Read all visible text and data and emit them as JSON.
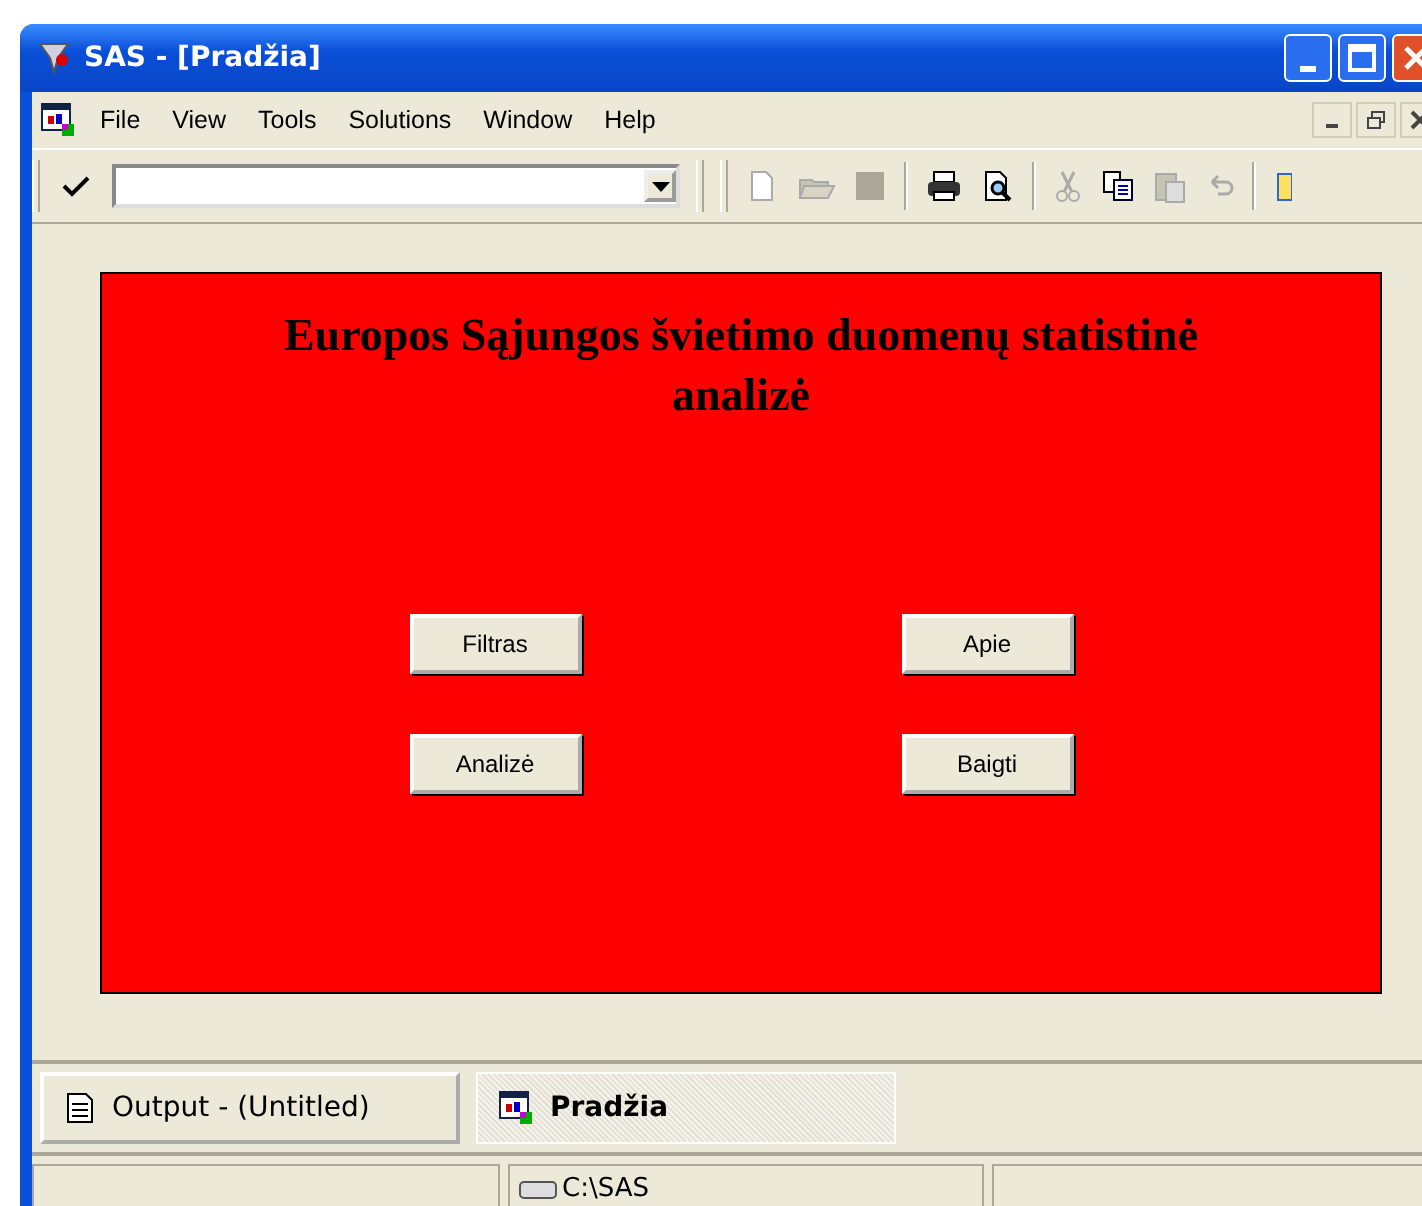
{
  "window": {
    "title": "SAS - [Pradžia]"
  },
  "menu": [
    "File",
    "View",
    "Tools",
    "Solutions",
    "Window",
    "Help"
  ],
  "form": {
    "title": "Europos Sąjungos švietimo duomenų statistinė analizė",
    "buttons": [
      {
        "label": "Filtras"
      },
      {
        "label": "Apie"
      },
      {
        "label": "Analizė"
      },
      {
        "label": "Baigti"
      }
    ]
  },
  "window_tabs": [
    {
      "label": "Output - (Untitled)",
      "kind": "output",
      "selected": false
    },
    {
      "label": "Pradžia",
      "kind": "program",
      "selected": true
    }
  ],
  "status_bar": {
    "path": "C:\\SAS"
  }
}
